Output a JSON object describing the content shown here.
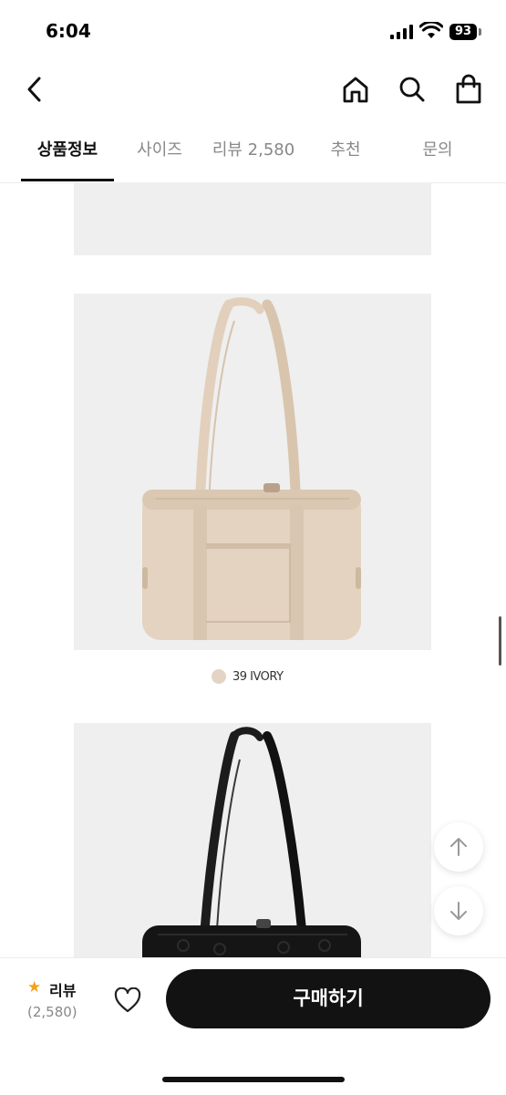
{
  "status": {
    "time": "6:04",
    "battery": "93"
  },
  "nav": {
    "icons": [
      "chevron-left-icon",
      "home-icon",
      "search-icon",
      "shopping-bag-icon"
    ]
  },
  "tabs": [
    {
      "label": "상품정보"
    },
    {
      "label": "사이즈"
    },
    {
      "label": "리뷰 2,580"
    },
    {
      "label": "추천"
    },
    {
      "label": "문의"
    }
  ],
  "content": {
    "caption": "39 IVORY"
  },
  "colors": {
    "accent": "#121212",
    "star": "#f3a21a",
    "ivory_swatch": "#e3d4c4",
    "panel_bg": "#efefef"
  },
  "bottom": {
    "review_label": "리뷰",
    "review_count": "(2,580)",
    "buy_label": "구매하기"
  }
}
